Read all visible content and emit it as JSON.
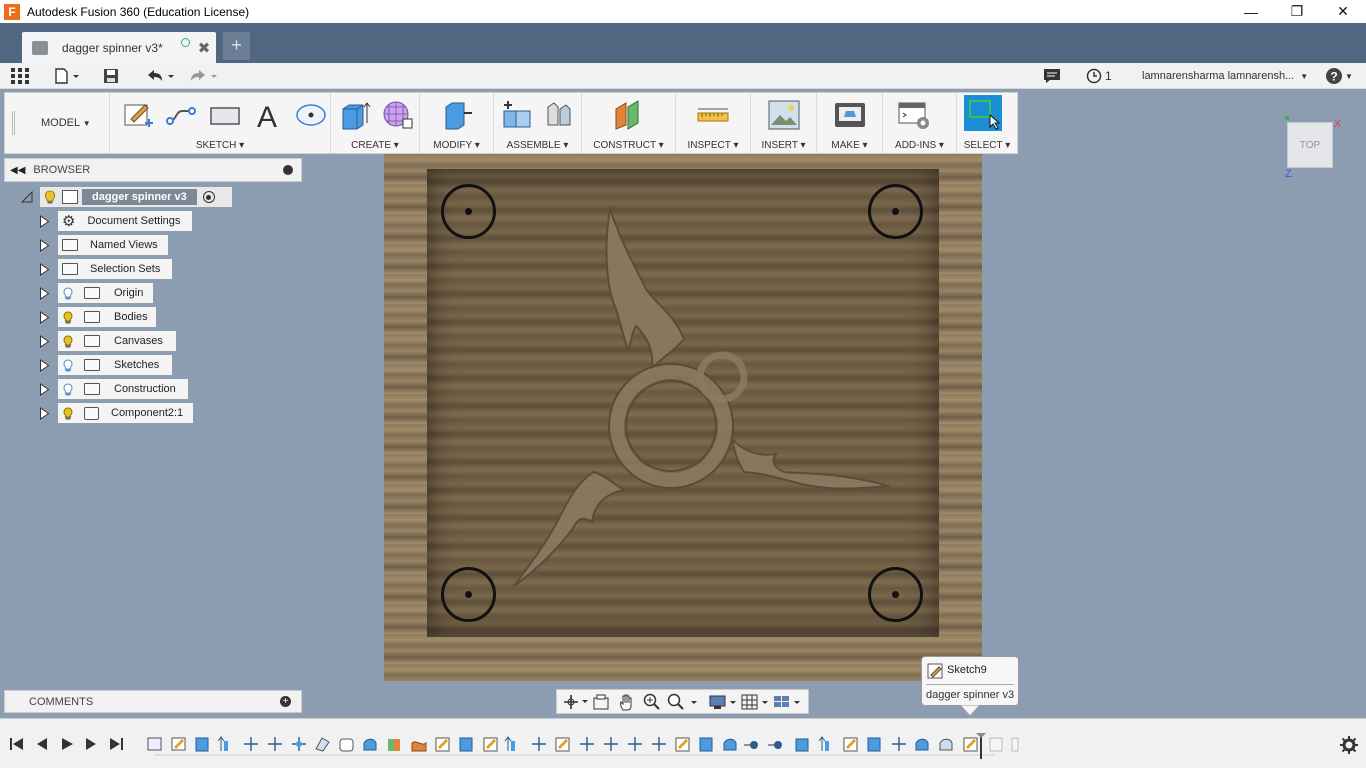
{
  "window": {
    "title": "Autodesk Fusion 360 (Education License)"
  },
  "tab": {
    "name": "dagger spinner v3*",
    "new_tab": "+"
  },
  "qat": {
    "jobs_count": "1",
    "user": "lamnarensharma lamnarensh..."
  },
  "toolbar": {
    "workspace": "MODEL",
    "groups": [
      "SKETCH",
      "CREATE",
      "MODIFY",
      "ASSEMBLE",
      "CONSTRUCT",
      "INSPECT",
      "INSERT",
      "MAKE",
      "ADD-INS",
      "SELECT"
    ]
  },
  "browser": {
    "title": "BROWSER",
    "root": "dagger spinner v3",
    "items": [
      {
        "label": "Document Settings",
        "icon": "gear-icon"
      },
      {
        "label": "Named Views",
        "icon": "folder-icon"
      },
      {
        "label": "Selection Sets",
        "icon": "folder-icon"
      },
      {
        "label": "Origin",
        "icon": "folder-icon",
        "bulb": "off"
      },
      {
        "label": "Bodies",
        "icon": "folder-icon",
        "bulb": "on"
      },
      {
        "label": "Canvases",
        "icon": "folder-icon",
        "bulb": "on"
      },
      {
        "label": "Sketches",
        "icon": "folder-icon",
        "bulb": "off"
      },
      {
        "label": "Construction",
        "icon": "folder-icon",
        "bulb": "off"
      },
      {
        "label": "Component2:1",
        "icon": "component-icon",
        "bulb": "on"
      }
    ]
  },
  "viewcube": {
    "face": "TOP",
    "x_axis": "X",
    "z_axis": "Z"
  },
  "comments": {
    "title": "COMMENTS"
  },
  "tooltip": {
    "feature": "Sketch9",
    "document": "dagger spinner v3"
  },
  "colors": {
    "tabbar": "#516781",
    "viewport": "#8c9db1",
    "select_active": "#1a8fd6",
    "bulb_on": "#e8c02a",
    "bulb_off": "#7aa8d8"
  }
}
